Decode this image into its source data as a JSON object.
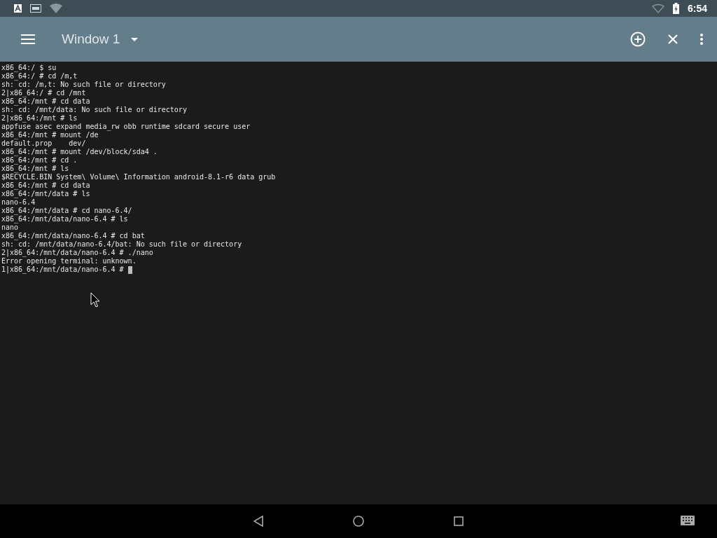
{
  "status_bar": {
    "time": "6:54"
  },
  "app_bar": {
    "title": "Window 1"
  },
  "terminal": {
    "lines": [
      "x86_64:/ $ su",
      "x86_64:/ # cd /m,t",
      "sh: cd: /m,t: No such file or directory",
      "2|x86_64:/ # cd /mnt",
      "x86_64:/mnt # cd data",
      "sh: cd: /mnt/data: No such file or directory",
      "2|x86_64:/mnt # ls",
      "appfuse asec expand media_rw obb runtime sdcard secure user",
      "x86_64:/mnt # mount /de",
      "default.prop    dev/",
      "x86_64:/mnt # mount /dev/block/sda4 .",
      "x86_64:/mnt # cd .",
      "x86_64:/mnt # ls",
      "$RECYCLE.BIN System\\ Volume\\ Information android-8.1-r6 data grub",
      "x86_64:/mnt # cd data",
      "x86_64:/mnt/data # ls",
      "nano-6.4",
      "x86_64:/mnt/data # cd nano-6.4/",
      "x86_64:/mnt/data/nano-6.4 # ls",
      "nano",
      "x86_64:/mnt/data/nano-6.4 # cd bat",
      "sh: cd: /mnt/data/nano-6.4/bat: No such file or directory",
      "2|x86_64:/mnt/data/nano-6.4 # ./nano",
      "Error opening terminal: unknown.",
      "1|x86_64:/mnt/data/nano-6.4 # "
    ]
  }
}
